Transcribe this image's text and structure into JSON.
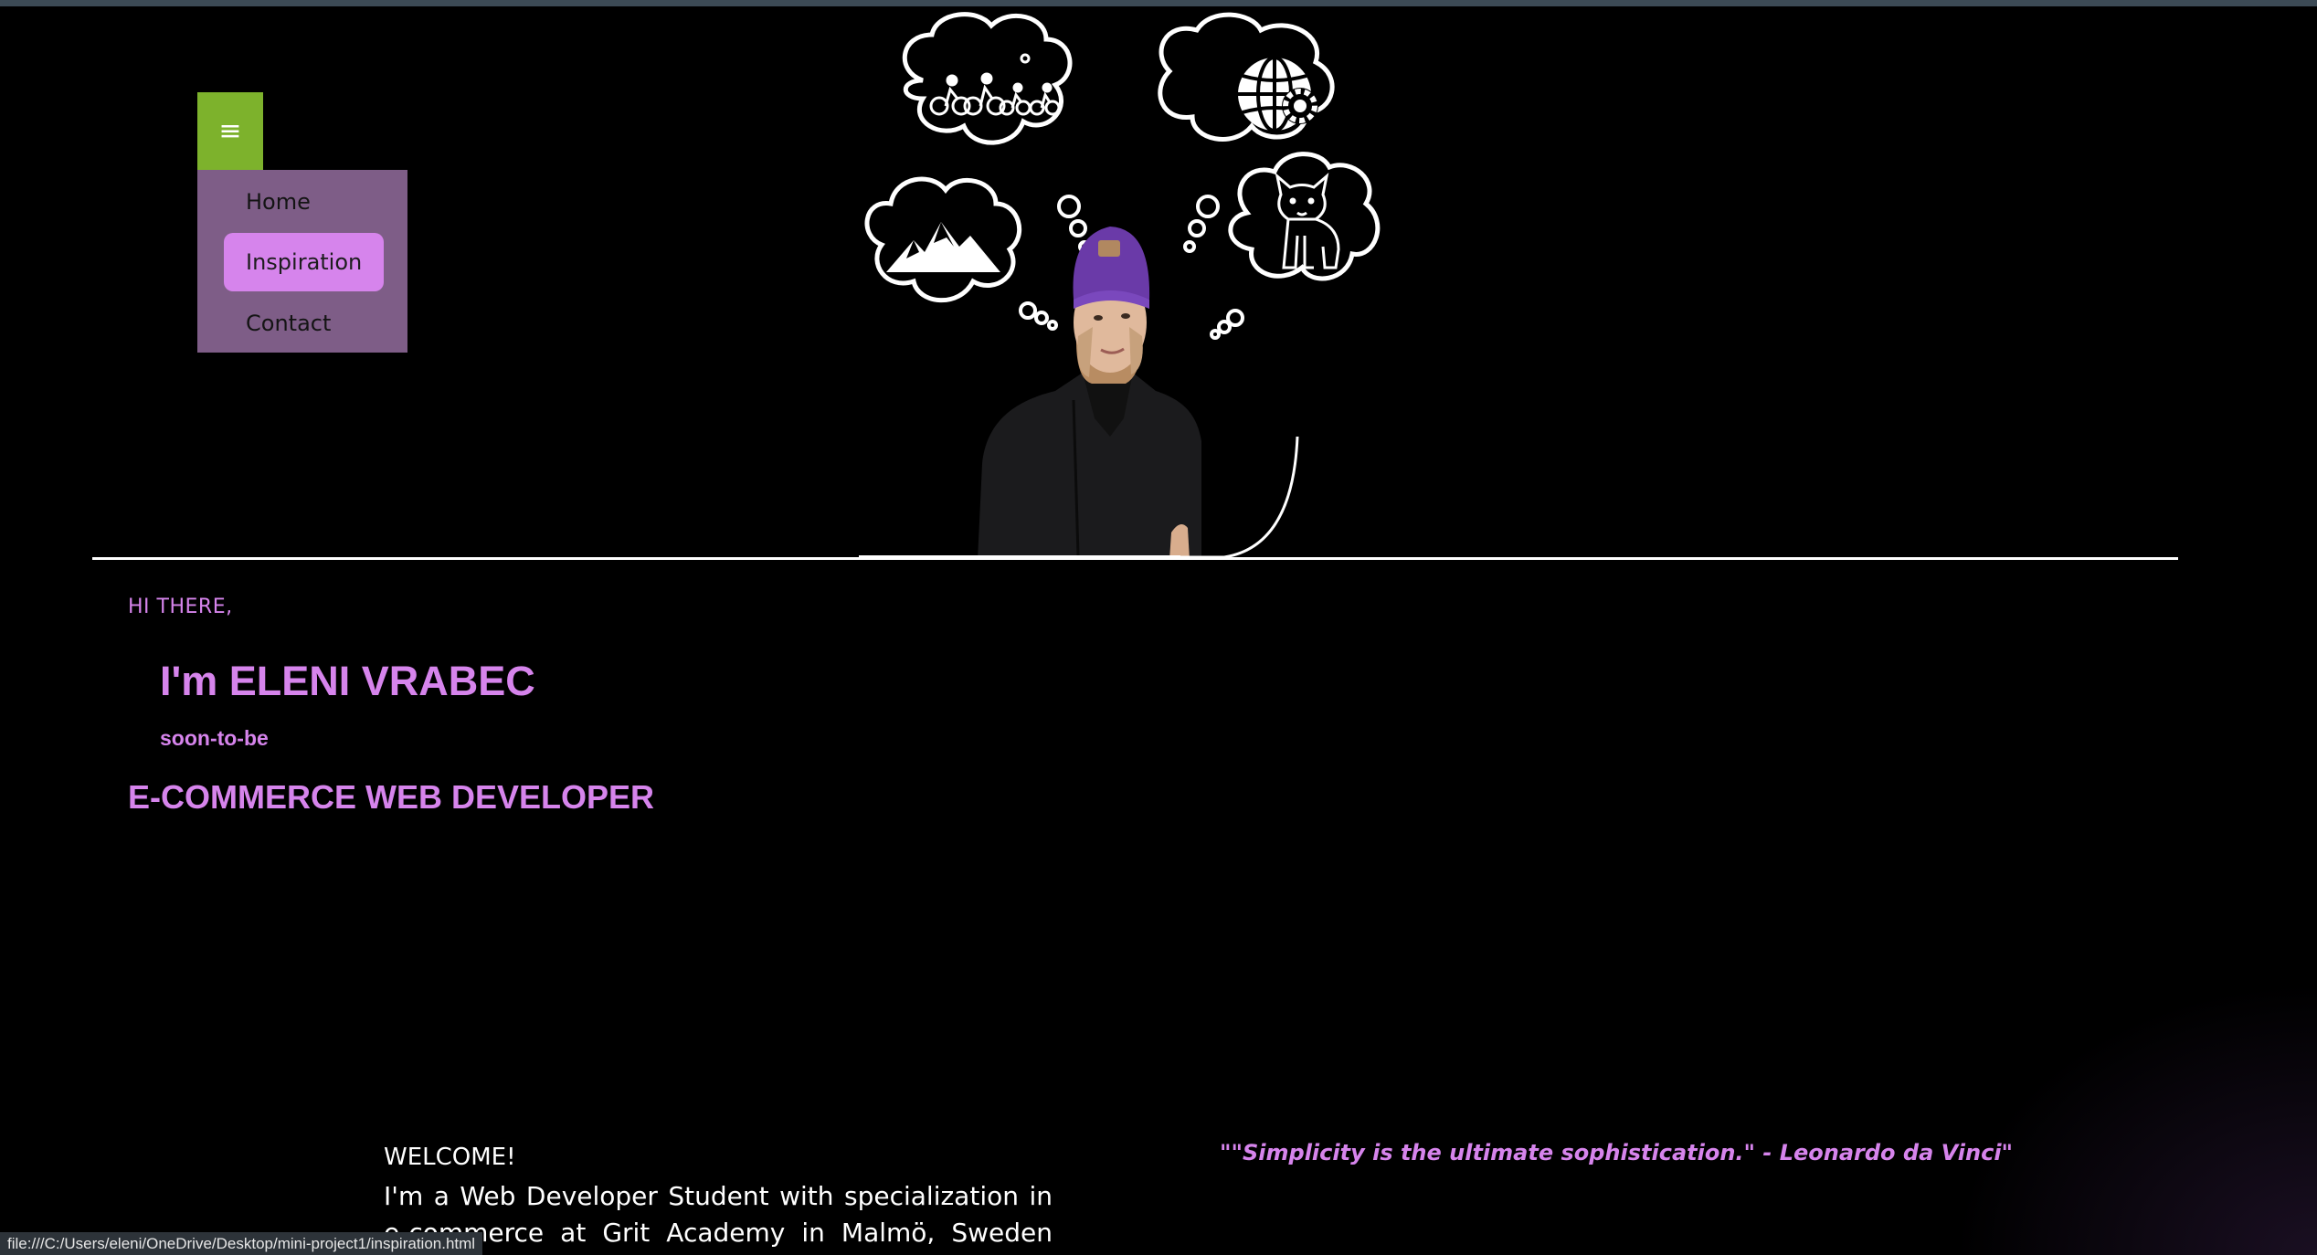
{
  "menu": {
    "toggle_icon": "hamburger-icon",
    "toggle_glyph": "≡",
    "toggle_color": "#7db22c",
    "panel_color": "#7e5d87",
    "active_color": "#d684ec",
    "items": [
      {
        "label": "Home",
        "active": false
      },
      {
        "label": "Inspiration",
        "active": true
      },
      {
        "label": "Contact",
        "active": false
      }
    ]
  },
  "hero": {
    "thought_icons": [
      "cyclists-icon",
      "globe-gear-icon",
      "mountains-icon",
      "french-bulldog-icon"
    ]
  },
  "intro": {
    "greeting": "HI THERE,",
    "name": "I'm ELENI VRABEC",
    "soon": "soon-to-be",
    "role": "E-COMMERCE WEB DEVELOPER"
  },
  "about": {
    "heading": "WELCOME!",
    "text": "I'm a Web Developer Student with specialization in e-commerce at Grit Academy in Malmö, Sweden and I really"
  },
  "quote": "\"\"Simplicity is the ultimate sophistication.\" - Leonardo da Vinci\"",
  "status_bar": "file:///C:/Users/eleni/OneDrive/Desktop/mini-project1/inspiration.html",
  "colors": {
    "accent": "#d684ec",
    "background": "#000000"
  }
}
